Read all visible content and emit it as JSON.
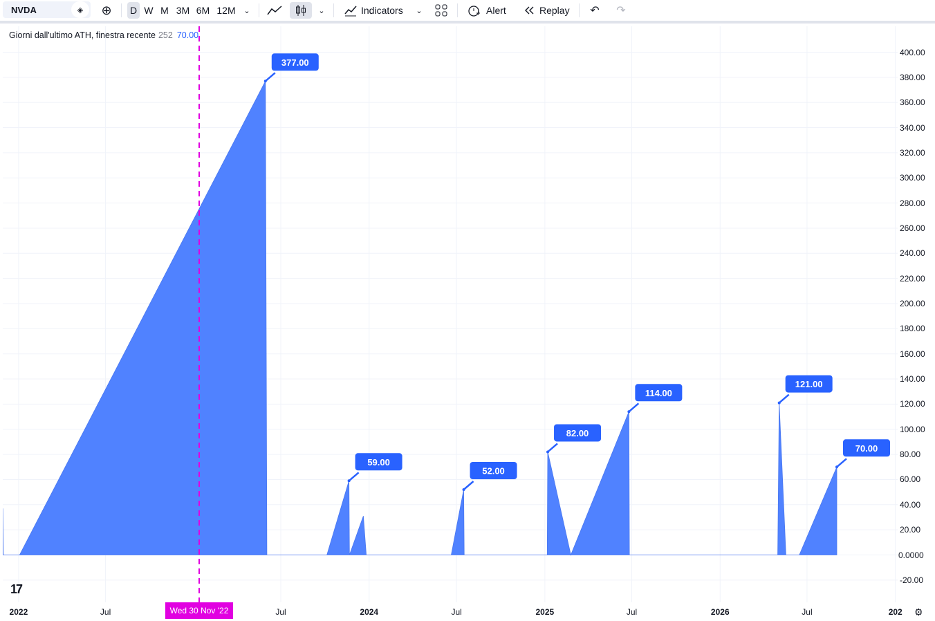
{
  "toolbar": {
    "symbol": "NVDA",
    "intervals": [
      "D",
      "W",
      "M",
      "3M",
      "6M",
      "12M"
    ],
    "active_interval": "D",
    "indicators_label": "Indicators",
    "alert_label": "Alert",
    "replay_label": "Replay"
  },
  "legend": {
    "name": "Giorni dall'ultimo ATH, finestra recente",
    "input": "252",
    "value": "70.00"
  },
  "crosshair": {
    "date_label": "Wed 30 Nov '22"
  },
  "colors": {
    "series": "#5082ff",
    "label_bg": "#2962ff",
    "crosshair": "#e100e1"
  },
  "chart_data": {
    "type": "area",
    "title": "",
    "xlabel": "",
    "ylabel": "",
    "ylim": [
      -20,
      400
    ],
    "yticks": [
      "400.00",
      "380.00",
      "360.00",
      "340.00",
      "320.00",
      "300.00",
      "280.00",
      "260.00",
      "240.00",
      "220.00",
      "200.00",
      "180.00",
      "160.00",
      "140.00",
      "120.00",
      "100.00",
      "80.00",
      "60.00",
      "40.00",
      "20.00",
      "0.0000",
      "-20.00"
    ],
    "xticks": [
      "2022",
      "Jul",
      "Jul",
      "2024",
      "Jul",
      "2025",
      "Jul",
      "2026",
      "Jul",
      "202"
    ],
    "grid": true,
    "series": [
      {
        "x": [
          "2021-11-29",
          "2021-11-30",
          "2021-12-03",
          "2021-12-08",
          "2021-12-13",
          "2021-12-17",
          "2021-12-22",
          "2022-01-03",
          "2023-05-30",
          "2023-06-02",
          "2023-06-09",
          "2023-06-13",
          "2023-06-20",
          "2023-06-23",
          "2023-07-14",
          "2023-07-17",
          "2023-07-21",
          "2023-07-27",
          "2023-08-04",
          "2023-08-10",
          "2023-08-17",
          "2023-08-31",
          "2023-09-05",
          "2023-09-11",
          "2023-09-18",
          "2023-10-05",
          "2023-11-20",
          "2023-11-21",
          "2023-12-20",
          "2023-12-26",
          "2024-01-10",
          "2024-01-18",
          "2024-02-02",
          "2024-02-08",
          "2024-02-16",
          "2024-02-26",
          "2024-03-08",
          "2024-03-10",
          "2024-05-30",
          "2024-06-03",
          "2024-06-10",
          "2024-06-11",
          "2024-06-18",
          "2024-06-20",
          "2024-07-16",
          "2024-07-17",
          "2024-07-24",
          "2024-08-05",
          "2024-08-14",
          "2024-08-30",
          "2024-09-20",
          "2024-09-27",
          "2024-10-04",
          "2024-10-10",
          "2024-11-08",
          "2024-11-11",
          "2024-11-18",
          "2025-01-06",
          "2025-01-07",
          "2025-02-24",
          "2025-06-25",
          "2025-06-26",
          "2025-07-02",
          "2025-07-18",
          "2025-07-24",
          "2025-08-29",
          "2025-10-03",
          "2025-10-07",
          "2025-10-17",
          "2025-10-28",
          "2025-11-03",
          "2026-05-01",
          "2026-05-04",
          "2026-05-18",
          "2026-05-27",
          "2026-06-15",
          "2026-09-01"
        ],
        "values": [
          37,
          0,
          0,
          0,
          0,
          0,
          0,
          0,
          377,
          0,
          0,
          0,
          0,
          0,
          0,
          0,
          0,
          0,
          0,
          0,
          0,
          0,
          0,
          0,
          0,
          0,
          59,
          0,
          31,
          0,
          0,
          0,
          0,
          0,
          0,
          0,
          0,
          0,
          0,
          0,
          0,
          0,
          0,
          0,
          52,
          0,
          0,
          0,
          0,
          0,
          0,
          0,
          0,
          0,
          0,
          0,
          0,
          0,
          82,
          0,
          114,
          0,
          0,
          0,
          0,
          0,
          0,
          0,
          0,
          0,
          0,
          0,
          121,
          0,
          0,
          0,
          70
        ]
      }
    ],
    "annotations": [
      "377.00",
      "59.00",
      "52.00",
      "82.00",
      "114.00",
      "121.00",
      "70.00"
    ]
  }
}
